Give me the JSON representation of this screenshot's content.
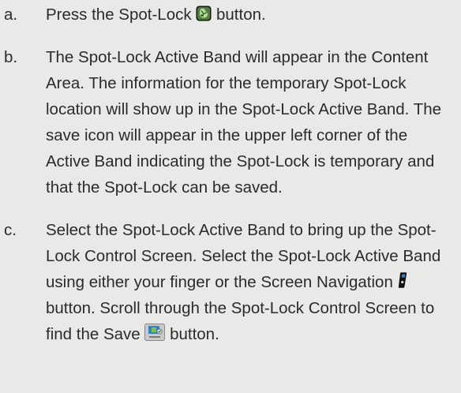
{
  "steps": [
    {
      "marker": "a.",
      "text_before": "Press the Spot-Lock",
      "icon": "spot-lock-icon",
      "text_after": "button."
    },
    {
      "marker": "b.",
      "text": "The Spot-Lock Active Band will appear in the Content Area. The information for the temporary Spot-Lock location will show up in the Spot-Lock Active Band. The save icon will appear in the upper left corner of the Active Band indicating the Spot-Lock is temporary and that the Spot-Lock can be saved."
    },
    {
      "marker": "c.",
      "text_1": "Select the Spot-Lock Active Band to bring up the Spot-Lock Control Screen. Select the Spot-Lock Active Band using either your finger or the Screen Navigation",
      "icon_1": "screen-navigation-icon",
      "text_2": "button. Scroll through the Spot-Lock Control Screen to find the Save",
      "icon_2": "save-icon",
      "text_3": "button."
    }
  ]
}
